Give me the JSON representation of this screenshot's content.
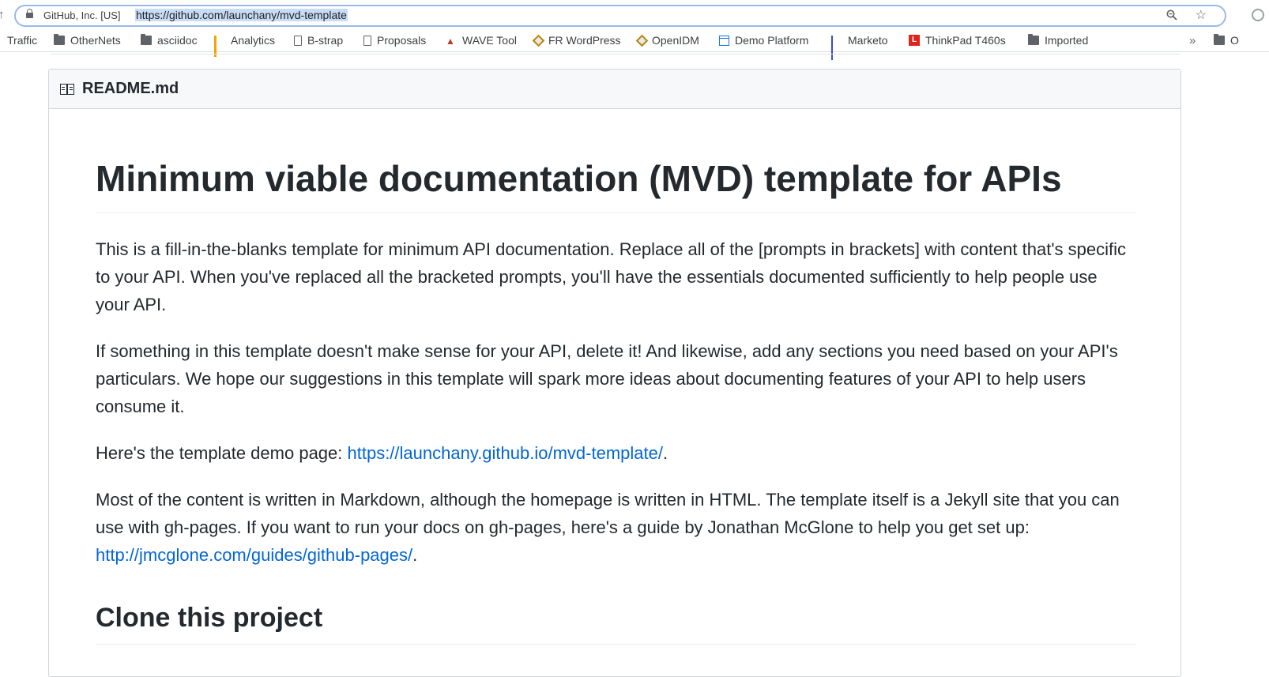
{
  "browser": {
    "site_identity": "GitHub, Inc. [US]",
    "url": "https://github.com/launchany/mvd-template"
  },
  "bookmarks": [
    {
      "label": "Traffic",
      "icon": "none"
    },
    {
      "label": "OtherNets",
      "icon": "folder-icon"
    },
    {
      "label": "asciidoc",
      "icon": "folder-icon"
    },
    {
      "label": "Analytics",
      "icon": "analytics-icon"
    },
    {
      "label": "B-strap",
      "icon": "page-icon"
    },
    {
      "label": "Proposals",
      "icon": "page-icon"
    },
    {
      "label": "WAVE Tool",
      "icon": "wave-icon"
    },
    {
      "label": "FR WordPress",
      "icon": "wordpress-icon"
    },
    {
      "label": "OpenIDM",
      "icon": "openidm-icon"
    },
    {
      "label": "Demo Platform",
      "icon": "calendar-icon"
    },
    {
      "label": "Marketo",
      "icon": "marketo-icon"
    },
    {
      "label": "ThinkPad T460s",
      "icon": "lenovo-icon"
    },
    {
      "label": "Imported",
      "icon": "folder-icon"
    },
    {
      "label": "O",
      "icon": "folder-icon"
    }
  ],
  "readme": {
    "filename": "README.md",
    "h1": "Minimum viable documentation (MVD) template for APIs",
    "p1": "This is a fill-in-the-blanks template for minimum API documentation. Replace all of the [prompts in brackets] with content that's specific to your API. When you've replaced all the bracketed prompts, you'll have the essentials documented sufficiently to help people use your API.",
    "p2": "If something in this template doesn't make sense for your API, delete it! And likewise, add any sections you need based on your API's particulars. We hope our suggestions in this template will spark more ideas about documenting features of your API to help users consume it.",
    "p3_prefix": "Here's the template demo page: ",
    "p3_link": "https://launchany.github.io/mvd-template/",
    "p3_suffix": ".",
    "p4_prefix": "Most of the content is written in Markdown, although the homepage is written in HTML. The template itself is a Jekyll site that you can use with gh-pages. If you want to run your docs on gh-pages, here's a guide by Jonathan McGlone to help you get set up: ",
    "p4_link": "http://jmcglone.com/guides/github-pages/",
    "p4_suffix": ".",
    "h2": "Clone this project"
  }
}
